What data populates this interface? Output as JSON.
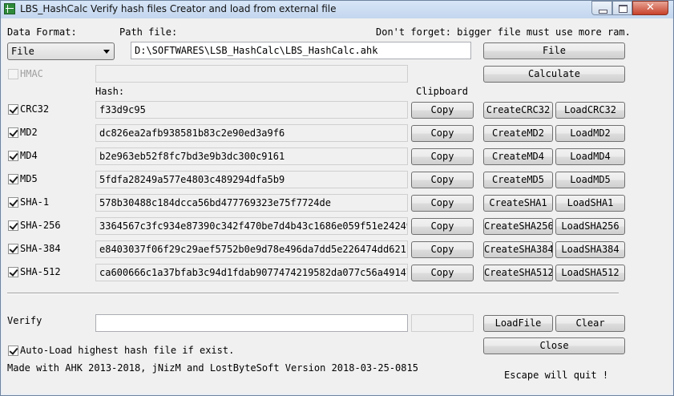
{
  "window": {
    "title": "LBS_HashCalc Verify hash files Creator and load from external file"
  },
  "header": {
    "data_format_label": "Data Format:",
    "path_file_label": "Path file:",
    "notice": "Don't forget: bigger file must use more ram."
  },
  "format_select": {
    "value": "File"
  },
  "path_input": {
    "value": "D:\\SOFTWARES\\LSB_HashCalc\\LBS_HashCalc.ahk"
  },
  "buttons": {
    "file": "File",
    "calculate": "Calculate",
    "loadfile": "LoadFile",
    "clear": "Clear",
    "close": "Close"
  },
  "hmac": {
    "label": "HMAC",
    "checked": false,
    "value": ""
  },
  "labels": {
    "hash": "Hash:",
    "clipboard": "Clipboard"
  },
  "hashes": [
    {
      "name": "CRC32",
      "checked": true,
      "value": "f33d9c95",
      "copy": "Copy",
      "create": "CreateCRC32",
      "load": "LoadCRC32"
    },
    {
      "name": "MD2",
      "checked": true,
      "value": "dc826ea2afb938581b83c2e90ed3a9f6",
      "copy": "Copy",
      "create": "CreateMD2",
      "load": "LoadMD2"
    },
    {
      "name": "MD4",
      "checked": true,
      "value": "b2e963eb52f8fc7bd3e9b3dc300c9161",
      "copy": "Copy",
      "create": "CreateMD4",
      "load": "LoadMD4"
    },
    {
      "name": "MD5",
      "checked": true,
      "value": "5fdfa28249a577e4803c489294dfa5b9",
      "copy": "Copy",
      "create": "CreateMD5",
      "load": "LoadMD5"
    },
    {
      "name": "SHA-1",
      "checked": true,
      "value": "578b30488c184dcca56bd477769323e75f7724de",
      "copy": "Copy",
      "create": "CreateSHA1",
      "load": "LoadSHA1"
    },
    {
      "name": "SHA-256",
      "checked": true,
      "value": "3364567c3fc934e87390c342f470be7d4b43c1686e059f51e24249f",
      "copy": "Copy",
      "create": "CreateSHA256",
      "load": "LoadSHA256"
    },
    {
      "name": "SHA-384",
      "checked": true,
      "value": "e8403037f06f29c29aef5752b0e9d78e496da7dd5e226474dd621b6",
      "copy": "Copy",
      "create": "CreateSHA384",
      "load": "LoadSHA384"
    },
    {
      "name": "SHA-512",
      "checked": true,
      "value": "ca600666c1a37bfab3c94d1fdab9077474219582da077c56a491478",
      "copy": "Copy",
      "create": "CreateSHA512",
      "load": "LoadSHA512"
    }
  ],
  "verify": {
    "label": "Verify",
    "value": "",
    "status": ""
  },
  "autoload": {
    "label": "Auto-Load highest hash file if exist.",
    "checked": true
  },
  "footer": {
    "credits": "Made with AHK 2013-2018, jNizM and LostByteSoft Version 2018-03-25-0815",
    "escape": "Escape will quit !"
  }
}
